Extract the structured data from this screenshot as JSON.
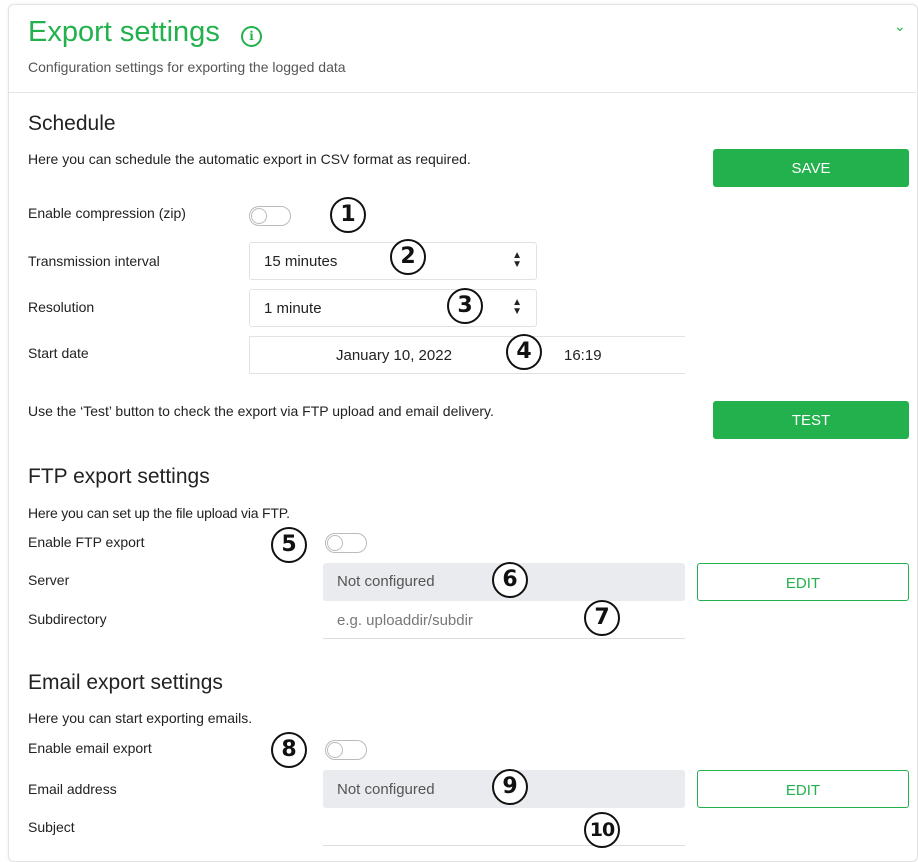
{
  "header": {
    "title": "Export settings",
    "info_icon": "info-icon",
    "subtitle": "Configuration settings for exporting the logged data",
    "collapse_icon": "chevron-down-icon"
  },
  "schedule": {
    "heading": "Schedule",
    "description": "Here you can schedule the automatic export in CSV format as required.",
    "save_label": "SAVE",
    "compression_label": "Enable compression (zip)",
    "compression_enabled": false,
    "interval_label": "Transmission interval",
    "interval_value": "15 minutes",
    "resolution_label": "Resolution",
    "resolution_value": "1 minute",
    "start_date_label": "Start date",
    "start_date_value": "January 10, 2022",
    "start_time_value": "16:19",
    "test_description": "Use the ‘Test’ button to check the export via FTP upload and email delivery.",
    "test_label": "TEST"
  },
  "ftp": {
    "heading": "FTP export settings",
    "description": "Here you can set up the file upload via FTP.",
    "enable_label": "Enable FTP export",
    "enabled": false,
    "server_label": "Server",
    "server_value": "Not configured",
    "edit_label": "EDIT",
    "subdirectory_label": "Subdirectory",
    "subdirectory_placeholder": "e.g. uploaddir/subdir"
  },
  "email": {
    "heading": "Email export settings",
    "description": "Here you can start exporting emails.",
    "enable_label": "Enable email export",
    "enabled": false,
    "address_label": "Email address",
    "address_value": "Not configured",
    "edit_label": "EDIT",
    "subject_label": "Subject",
    "subject_value": ""
  },
  "callouts": [
    "1",
    "2",
    "3",
    "4",
    "5",
    "6",
    "7",
    "8",
    "9",
    "10"
  ],
  "colors": {
    "accent": "#22b14c",
    "field_gray": "#e9ebee",
    "text": "#222222"
  }
}
